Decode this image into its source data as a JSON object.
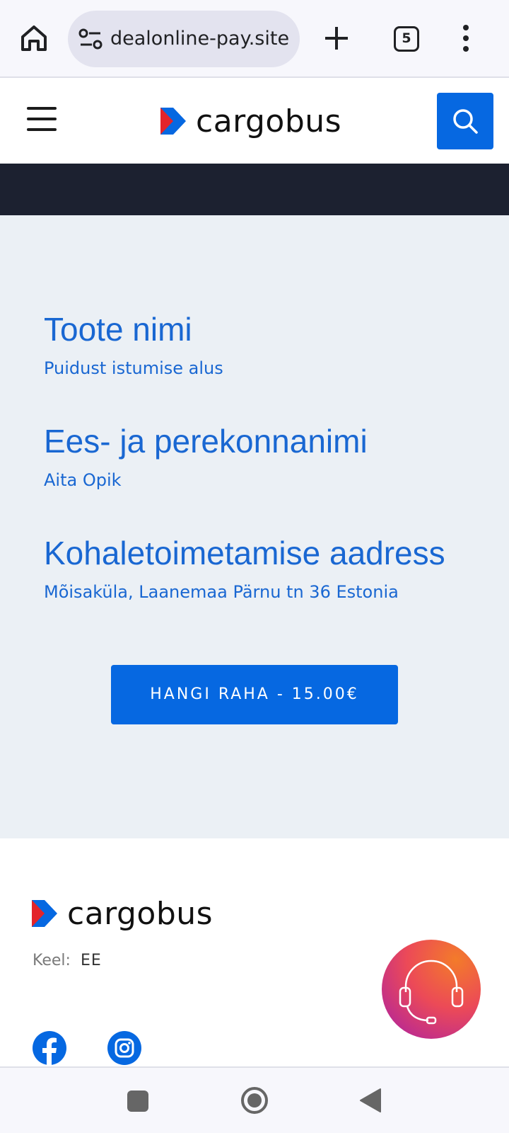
{
  "browser": {
    "url": "dealonline-pay.site",
    "tab_count": "5",
    "icons": [
      "home-icon",
      "site-settings-icon",
      "plus-icon",
      "tab-switcher-icon",
      "more-vert-icon"
    ]
  },
  "header": {
    "brand_name": "cargobus",
    "icons": [
      "hamburger-icon",
      "search-icon"
    ]
  },
  "order": {
    "fields": [
      {
        "label": "Toote nimi",
        "value": "Puidust istumise alus"
      },
      {
        "label": "Ees- ja perekonnanimi",
        "value": "Aita Opik"
      },
      {
        "label": "Kohaletoimetamise aadress",
        "value": "Mõisaküla, Laanemaa Pärnu tn 36 Estonia"
      }
    ],
    "pay_button_label": "HANGI RAHA - 15.00€"
  },
  "footer": {
    "brand_name": "cargobus",
    "language_label": "Keel:",
    "language_value": "EE",
    "social_icons": [
      "facebook-icon",
      "instagram-icon"
    ]
  },
  "support": {
    "icon": "headset-icon"
  },
  "colors": {
    "brand_blue": "#0668e1",
    "text_blue": "#1967d2",
    "dark_band": "#1c2130",
    "main_bg": "#ebf0f5",
    "logo_red": "#e3242b"
  }
}
